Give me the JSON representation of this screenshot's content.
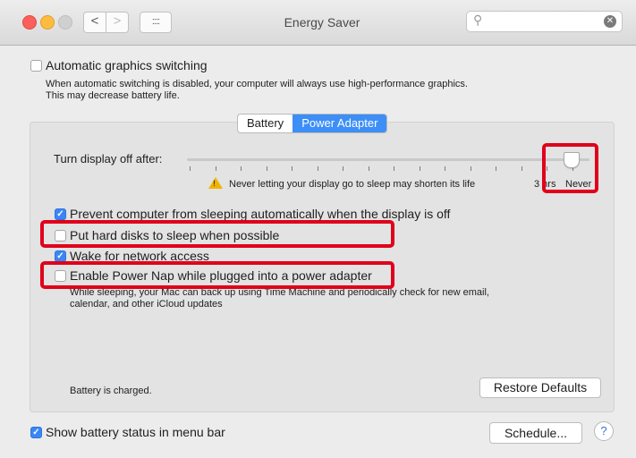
{
  "window": {
    "title": "Energy Saver"
  },
  "toolbar": {
    "back": "<",
    "forward": ">",
    "show_all": "::::"
  },
  "search": {
    "placeholder": "",
    "clear": "✕",
    "icon": "search-icon"
  },
  "auto_graphics": {
    "label": "Automatic graphics switching",
    "checked": false,
    "description_line1": "When automatic switching is disabled, your computer will always use high-performance graphics.",
    "description_line2": "This may decrease battery life."
  },
  "tabs": [
    {
      "label": "Battery",
      "selected": false
    },
    {
      "label": "Power Adapter",
      "selected": true
    }
  ],
  "display_slider": {
    "label": "Turn display off after:",
    "value": "Never",
    "tick_3hrs": "3 hrs",
    "tick_never": "Never",
    "warning": "Never letting your display go to sleep may shorten its life"
  },
  "options": {
    "prevent_sleep": {
      "label": "Prevent computer from sleeping automatically when the display is off",
      "checked": true
    },
    "hard_disks": {
      "label": "Put hard disks to sleep when possible",
      "checked": false
    },
    "wake_network": {
      "label": "Wake for network access",
      "checked": true
    },
    "power_nap": {
      "label": "Enable Power Nap while plugged into a power adapter",
      "checked": false,
      "description_line1": "While sleeping, your Mac can back up using Time Machine and periodically check for new email,",
      "description_line2": "calendar, and other iCloud updates"
    }
  },
  "status": {
    "battery": "Battery is charged."
  },
  "buttons": {
    "restore_defaults": "Restore Defaults",
    "schedule": "Schedule...",
    "help": "?"
  },
  "menu_bar": {
    "label": "Show battery status in menu bar",
    "checked": true
  },
  "colors": {
    "accent": "#3e8ef7",
    "highlight_box": "#e0001b",
    "warning": "#f0b400"
  }
}
